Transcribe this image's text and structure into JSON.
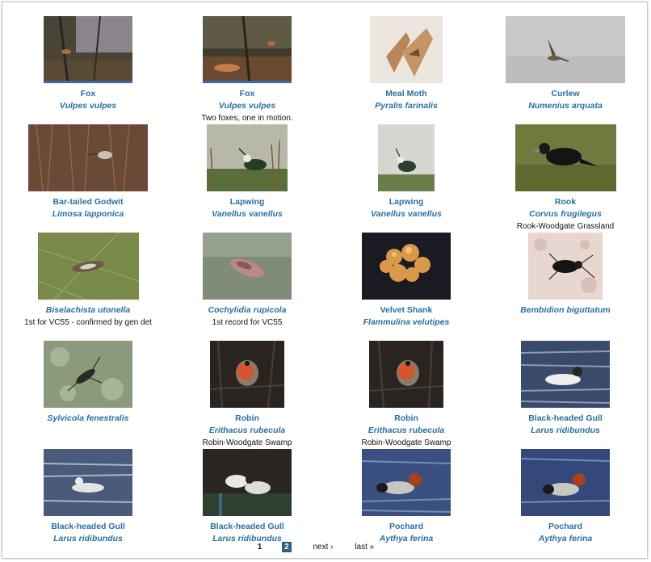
{
  "gallery": {
    "items": [
      {
        "common": "Fox",
        "scientific": "Vulpes vulpes",
        "note": "",
        "thumb": "fox-photo"
      },
      {
        "common": "Fox",
        "scientific": "Vulpes vulpes",
        "note": "Two foxes, one in motion.",
        "thumb": "fox-photo"
      },
      {
        "common": "Meal Moth",
        "scientific": "Pyralis farinalis",
        "note": "",
        "thumb": "moth-photo"
      },
      {
        "common": "Curlew",
        "scientific": "Numenius arquata",
        "note": "",
        "thumb": "curlew-photo"
      },
      {
        "common": "Bar-tailed Godwit",
        "scientific": "Limosa lapponica",
        "note": "",
        "thumb": "godwit-photo"
      },
      {
        "common": "Lapwing",
        "scientific": "Vanellus vanellus",
        "note": "",
        "thumb": "lapwing-photo"
      },
      {
        "common": "Lapwing",
        "scientific": "Vanellus vanellus",
        "note": "",
        "thumb": "lapwing-photo"
      },
      {
        "common": "Rook",
        "scientific": "Corvus frugilegus",
        "note": "Rook-Woodgate Grassland",
        "thumb": "rook-photo"
      },
      {
        "common": "",
        "scientific": "Biselachista utonella",
        "note": "1st for VC55 - confirmed by gen det",
        "thumb": "moth-photo"
      },
      {
        "common": "",
        "scientific": "Cochylidia rupicola",
        "note": "1st record for VC55",
        "thumb": "moth-photo"
      },
      {
        "common": "Velvet Shank",
        "scientific": "Flammulina velutipes",
        "note": "",
        "thumb": "fungus-photo"
      },
      {
        "common": "",
        "scientific": "Bembidion biguttatum",
        "note": "",
        "thumb": "beetle-photo"
      },
      {
        "common": "",
        "scientific": "Sylvicola fenestralis",
        "note": "",
        "thumb": "fly-photo"
      },
      {
        "common": "Robin",
        "scientific": "Erithacus rubecula",
        "note": "Robin-Woodgate Swamp",
        "thumb": "robin-photo"
      },
      {
        "common": "Robin",
        "scientific": "Erithacus rubecula",
        "note": "Robin-Woodgate Swamp",
        "thumb": "robin-photo"
      },
      {
        "common": "Black-headed Gull",
        "scientific": "Larus ridibundus",
        "note": "",
        "thumb": "gull-photo"
      },
      {
        "common": "Black-headed Gull",
        "scientific": "Larus ridibundus",
        "note": "",
        "thumb": "gull-photo"
      },
      {
        "common": "Black-headed Gull",
        "scientific": "Larus ridibundus",
        "note": "",
        "thumb": "gull-photo"
      },
      {
        "common": "Pochard",
        "scientific": "Aythya ferina",
        "note": "",
        "thumb": "pochard-photo"
      },
      {
        "common": "Pochard",
        "scientific": "Aythya ferina",
        "note": "",
        "thumb": "pochard-photo"
      }
    ]
  },
  "pager": {
    "page1": "1",
    "current": "2",
    "next": "next ›",
    "last": "last »"
  }
}
